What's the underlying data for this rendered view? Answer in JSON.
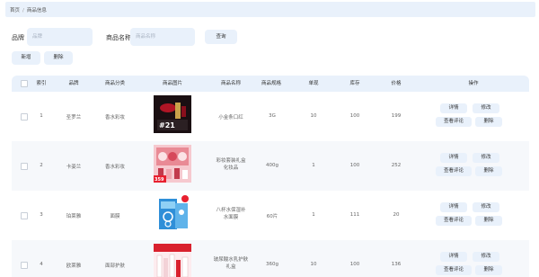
{
  "breadcrumb": {
    "home": "首页",
    "separator": "/",
    "current": "商品信息"
  },
  "search": {
    "brand_label": "品牌",
    "brand_placeholder": "品牌",
    "name_label": "商品名称",
    "name_placeholder": "商品名称",
    "query_button": "查询"
  },
  "toolbar": {
    "add_button": "新增",
    "delete_button": "删除"
  },
  "table": {
    "headers": [
      "索引",
      "品牌",
      "商品分类",
      "商品图片",
      "商品名称",
      "商品规格",
      "单现",
      "库存",
      "价格",
      "操作"
    ],
    "rows": [
      {
        "index": "1",
        "brand": "圣罗兰",
        "category": "香水彩妆",
        "image": "lipstick-product-image",
        "name": "小金条口红",
        "spec": "3G",
        "unit": "10",
        "stock": "100",
        "price": "199"
      },
      {
        "index": "2",
        "brand": "卡姿兰",
        "category": "香水彩妆",
        "image": "makeup-gift-set-image",
        "name_line1": "彩妆套装礼盒",
        "name_line2": "化妆品",
        "spec": "400g",
        "unit": "1",
        "stock": "100",
        "price": "252"
      },
      {
        "index": "3",
        "brand": "珀莱雅",
        "category": "面膜",
        "image": "hydrating-mask-image",
        "name_line1": "八杯水保湿补",
        "name_line2": "水面膜",
        "spec": "60片",
        "unit": "1",
        "stock": "111",
        "price": "20"
      },
      {
        "index": "4",
        "brand": "欧莱雅",
        "category": "面部护肤",
        "image": "skincare-set-image",
        "name_line1": "玻尿酸水乳护肤",
        "name_line2": "礼盒",
        "spec": "360g",
        "unit": "10",
        "stock": "100",
        "price": "136"
      }
    ],
    "actions": {
      "detail": "详情",
      "edit": "修改",
      "reviews": "查看评论",
      "delete": "删除"
    }
  },
  "colors": {
    "accent_bg": "#e9f1fb",
    "row_alt": "#f6f8fb",
    "text": "#333333",
    "muted": "#666666"
  }
}
